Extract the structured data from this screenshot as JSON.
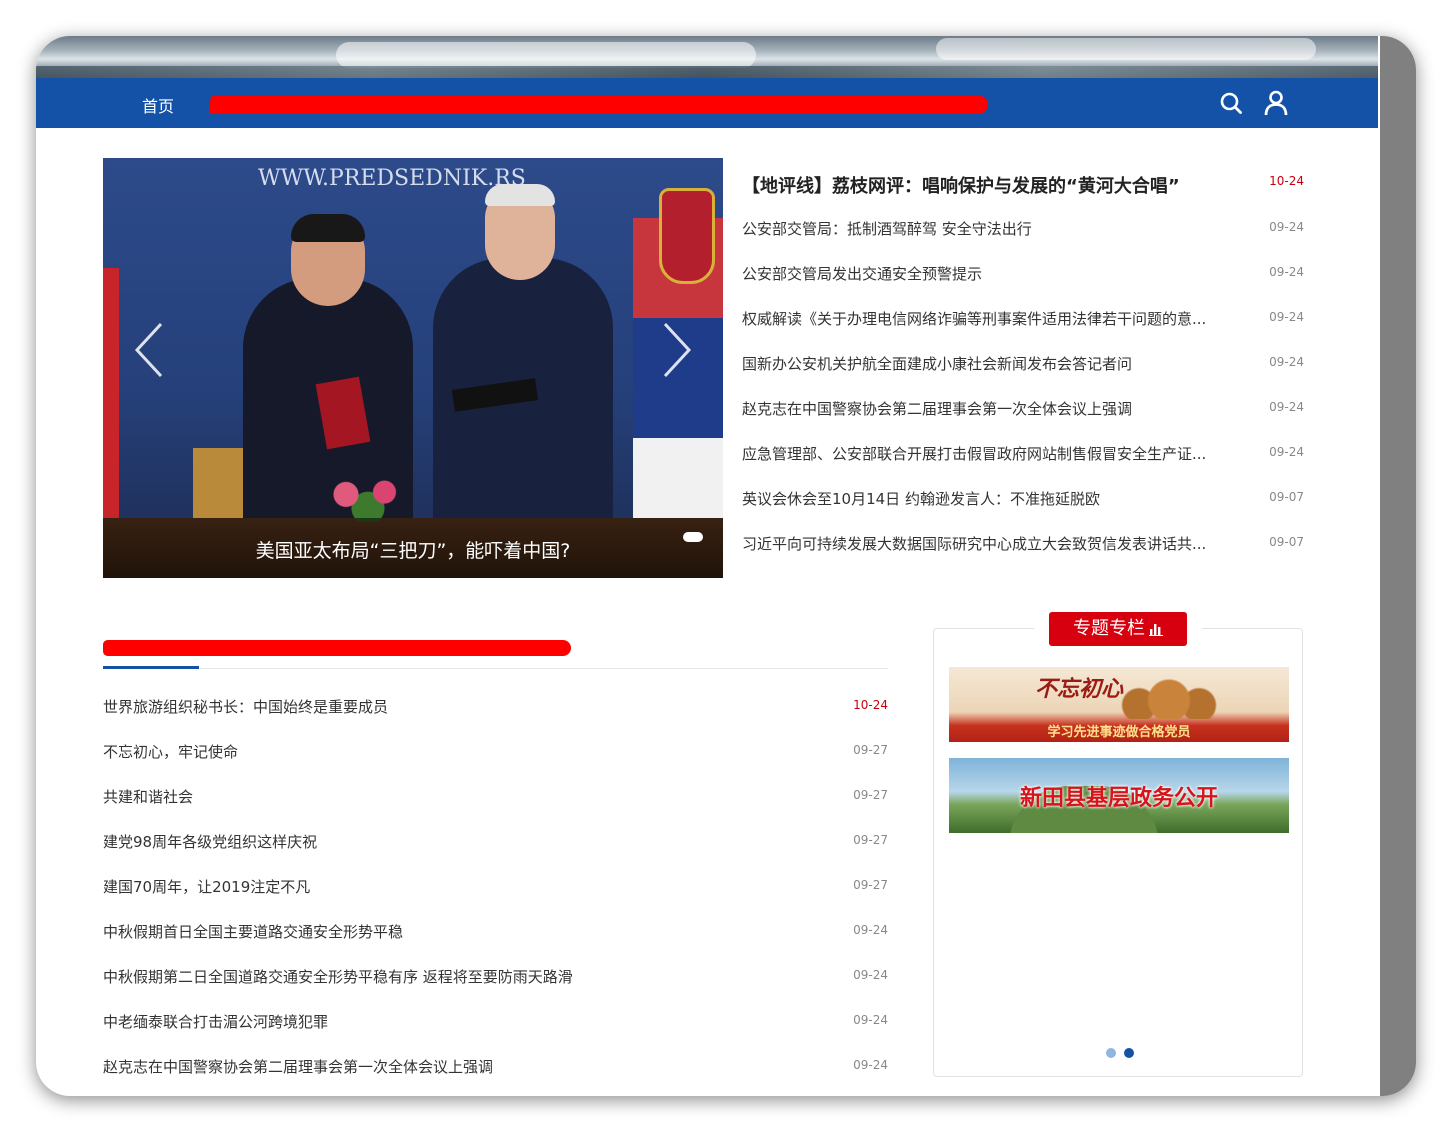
{
  "nav": {
    "home_label": "首页"
  },
  "slider": {
    "image_caption_text": "WWW.PREDSEDNIK.RS",
    "caption": "美国亚太布局“三把刀”，能吓着中国?"
  },
  "top_news": [
    {
      "title": "【地评线】荔枝网评：唱响保护与发展的“黄河大合唱”",
      "date": "10-24"
    },
    {
      "title": "公安部交管局：抵制酒驾醉驾 安全守法出行",
      "date": "09-24"
    },
    {
      "title": "公安部交管局发出交通安全预警提示",
      "date": "09-24"
    },
    {
      "title": "权威解读《关于办理电信网络诈骗等刑事案件适用法律若干问题的意...",
      "date": "09-24"
    },
    {
      "title": "国新办公安机关护航全面建成小康社会新闻发布会答记者问",
      "date": "09-24"
    },
    {
      "title": "赵克志在中国警察协会第二届理事会第一次全体会议上强调",
      "date": "09-24"
    },
    {
      "title": "应急管理部、公安部联合开展打击假冒政府网站制售假冒安全生产证...",
      "date": "09-24"
    },
    {
      "title": "英议会休会至10月14日 约翰逊发言人：不准拖延脱欧",
      "date": "09-07"
    },
    {
      "title": "习近平向可持续发展大数据国际研究中心成立大会致贺信发表讲话共...",
      "date": "09-07"
    }
  ],
  "tab_news": [
    {
      "title": "世界旅游组织秘书长：中国始终是重要成员",
      "date": "10-24"
    },
    {
      "title": "不忘初心，牢记使命",
      "date": "09-27"
    },
    {
      "title": "共建和谐社会",
      "date": "09-27"
    },
    {
      "title": "建党98周年各级党组织这样庆祝",
      "date": "09-27"
    },
    {
      "title": "建国70周年，让2019注定不凡",
      "date": "09-27"
    },
    {
      "title": "中秋假期首日全国主要道路交通安全形势平稳",
      "date": "09-24"
    },
    {
      "title": "中秋假期第二日全国道路交通安全形势平稳有序 返程将至要防雨天路滑",
      "date": "09-24"
    },
    {
      "title": "中老缅泰联合打击湄公河跨境犯罪",
      "date": "09-24"
    },
    {
      "title": "赵克志在中国警察协会第二届理事会第一次全体会议上强调",
      "date": "09-24"
    }
  ],
  "special": {
    "title": "专题专栏",
    "banner1_big": "不忘初心",
    "banner1_text": "学习先进事迹做合格党员",
    "banner2_text": "新田县基层政务公开"
  },
  "colors": {
    "nav_blue": "#1352a7",
    "accent_red": "#d7000f",
    "date_red": "#c7000b"
  },
  "icons": [
    "search-icon",
    "user-icon",
    "arrow-left-icon",
    "arrow-right-icon",
    "bar-chart-icon"
  ]
}
